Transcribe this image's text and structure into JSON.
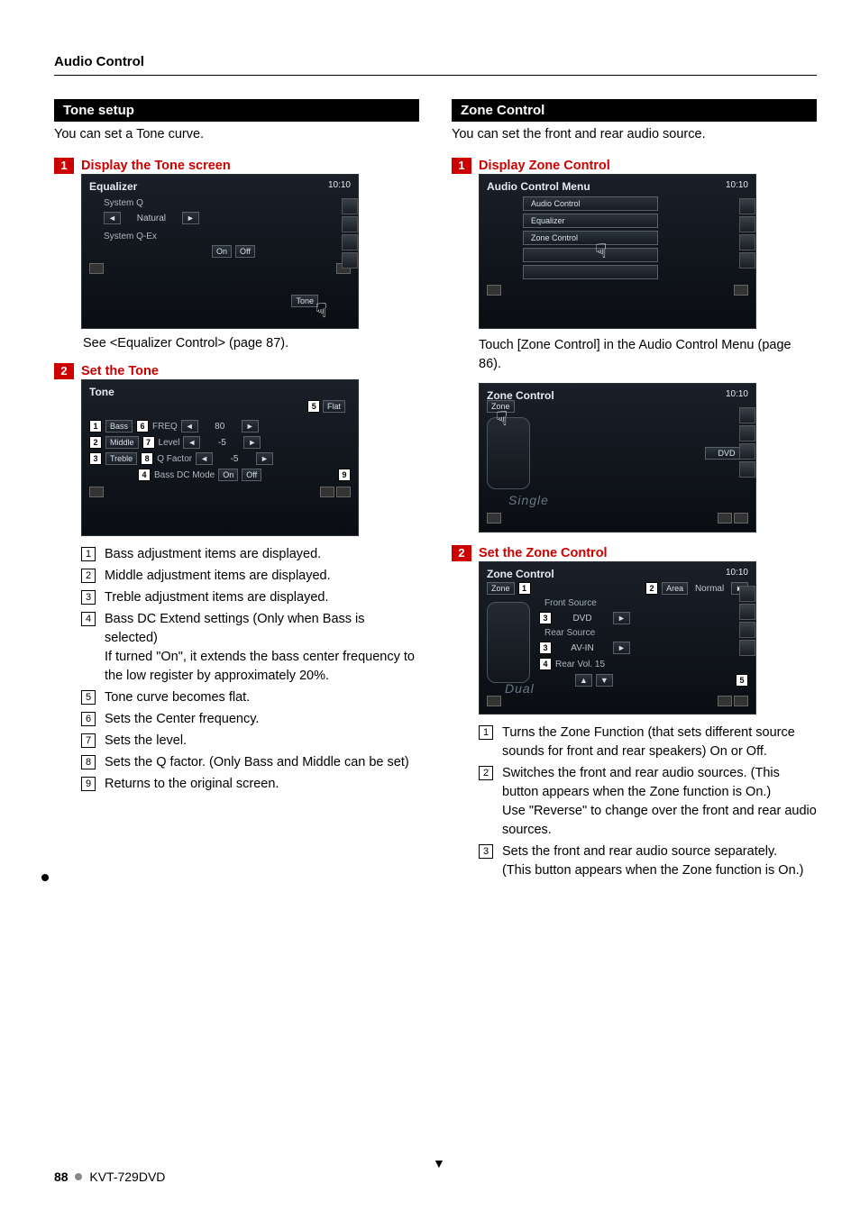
{
  "header": {
    "section": "Audio Control"
  },
  "left": {
    "band": "Tone setup",
    "intro": "You can set a Tone curve.",
    "step1": {
      "num": "1",
      "title": "Display the Tone screen"
    },
    "eq_screen": {
      "title": "Equalizer",
      "clock": "10:10",
      "row1_label": "System Q",
      "row1_value": "Natural",
      "row2_label": "System Q-Ex",
      "row2_on": "On",
      "row2_off": "Off",
      "tone_btn": "Tone"
    },
    "caption1": "See <Equalizer Control> (page 87).",
    "step2": {
      "num": "2",
      "title": "Set the Tone"
    },
    "tone_screen": {
      "title": "Tone",
      "clock": "",
      "flat": "Flat",
      "rows": {
        "bass": "Bass",
        "middle": "Middle",
        "treble": "Treble",
        "freq": "FREQ",
        "level": "Level",
        "qfactor": "Q Factor",
        "val_freq": "80",
        "val_level": "-5",
        "val_q": "-5",
        "bassdc": "Bass DC Mode",
        "on": "On",
        "off": "Off"
      },
      "callouts": {
        "c1": "1",
        "c2": "2",
        "c3": "3",
        "c4": "4",
        "c5": "5",
        "c6": "6",
        "c7": "7",
        "c8": "8",
        "c9": "9"
      }
    },
    "list": [
      {
        "n": "1",
        "t": "Bass adjustment items are displayed."
      },
      {
        "n": "2",
        "t": "Middle adjustment items are displayed."
      },
      {
        "n": "3",
        "t": "Treble adjustment items are displayed."
      },
      {
        "n": "4",
        "t": "Bass DC Extend settings (Only when Bass is selected)\nIf turned \"On\", it extends the bass center frequency to the low register by approximately 20%."
      },
      {
        "n": "5",
        "t": "Tone curve becomes flat."
      },
      {
        "n": "6",
        "t": "Sets the Center frequency."
      },
      {
        "n": "7",
        "t": "Sets the level."
      },
      {
        "n": "8",
        "t": "Sets the Q factor. (Only Bass and Middle can be set)"
      },
      {
        "n": "9",
        "t": "Returns to the original screen."
      }
    ]
  },
  "right": {
    "band": "Zone Control",
    "intro": "You can set the front and rear audio source.",
    "step1": {
      "num": "1",
      "title": "Display Zone Control"
    },
    "menu_screen": {
      "title": "Audio Control Menu",
      "clock": "10:10",
      "items": [
        "Audio Control",
        "Equalizer",
        "Zone Control"
      ]
    },
    "caption1": "Touch [Zone Control] in the Audio Control Menu (page 86).",
    "zone_screen1": {
      "title": "Zone Control",
      "clock": "10:10",
      "zone_btn": "Zone",
      "dvd": "DVD",
      "mode": "Single"
    },
    "step2": {
      "num": "2",
      "title": "Set the Zone Control"
    },
    "zone_screen2": {
      "title": "Zone Control",
      "clock": "10:10",
      "zone_btn": "Zone",
      "area": "Area",
      "area_val": "Normal",
      "front_src": "Front Source",
      "front_val": "DVD",
      "rear_src": "Rear Source",
      "rear_val": "AV-IN",
      "rear_vol": "Rear Vol. 15",
      "mode": "Dual",
      "callouts": {
        "c1": "1",
        "c2": "2",
        "c3a": "3",
        "c3b": "3",
        "c4": "4",
        "c5": "5"
      }
    },
    "list": [
      {
        "n": "1",
        "t": "Turns the Zone Function (that sets different source sounds for front and rear speakers) On or Off."
      },
      {
        "n": "2",
        "t": "Switches the front and rear audio sources. (This button appears when the Zone function is On.)\nUse \"Reverse\" to change over the front and rear audio sources."
      },
      {
        "n": "3",
        "t": "Sets the front and rear audio source separately.\n(This button appears when the Zone function is On.)"
      }
    ]
  },
  "footer": {
    "page": "88",
    "model": "KVT-729DVD"
  }
}
